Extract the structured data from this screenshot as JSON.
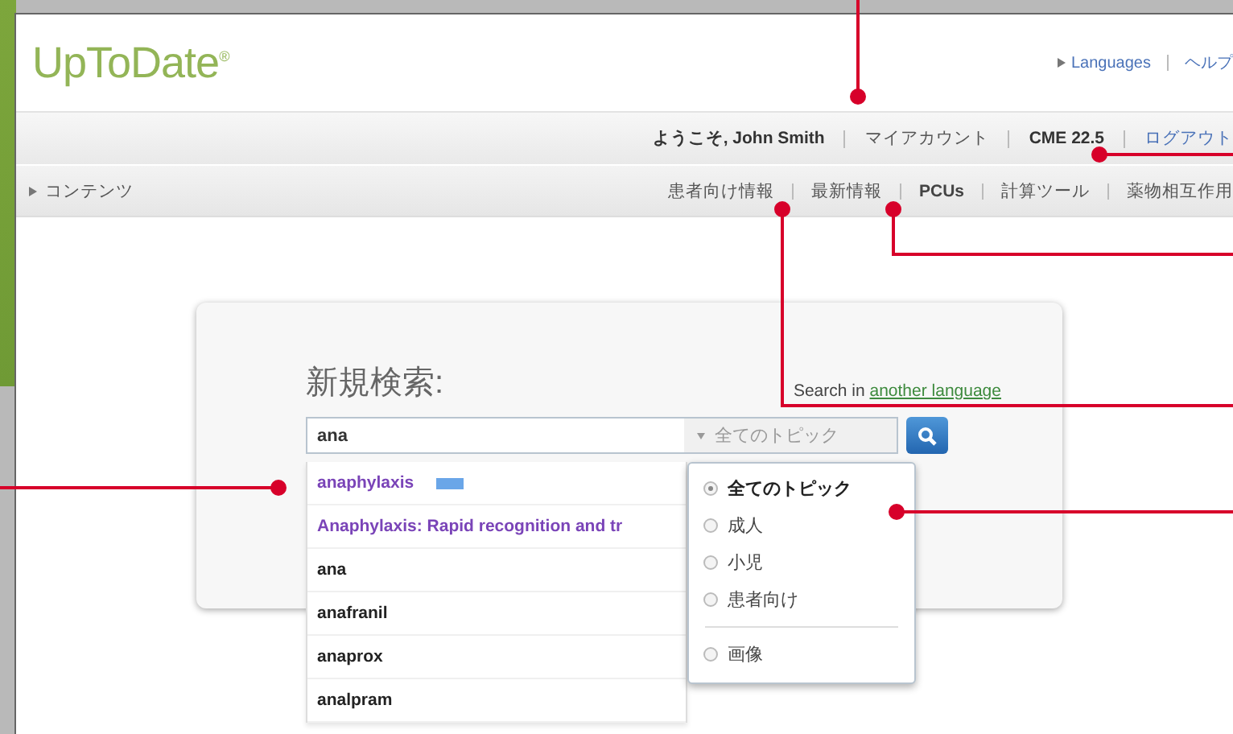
{
  "header": {
    "logo": "UpToDate",
    "logo_mark": "®",
    "links": [
      {
        "label": "Languages",
        "caret": true
      },
      {
        "label": "ヘルプ",
        "caret": false
      }
    ]
  },
  "user_bar": {
    "items": [
      {
        "text": "ようこそ, John Smith",
        "kind": "bold"
      },
      {
        "text": "マイアカウント",
        "kind": "plain"
      },
      {
        "text": "CME 22.5",
        "kind": "bold"
      },
      {
        "text": "ログアウト",
        "kind": "link"
      }
    ]
  },
  "nav": {
    "menu": "コンテンツ",
    "items": [
      {
        "label": "患者向け情報",
        "kind": "plain"
      },
      {
        "label": "最新情報",
        "kind": "plain"
      },
      {
        "label": "PCUs",
        "kind": "bold"
      },
      {
        "label": "計算ツール",
        "kind": "plain"
      },
      {
        "label": "薬物相互作用",
        "kind": "plain"
      }
    ]
  },
  "search": {
    "title": "新規検索:",
    "language_prefix": "Search in",
    "language_link": "another language",
    "query": "ana",
    "topic": "全てのトピック",
    "suggestions": [
      {
        "text": "anaphylaxis",
        "kind": "topic",
        "badge": true
      },
      {
        "text": "Anaphylaxis: Rapid recognition and tr",
        "kind": "topic",
        "badge": false
      },
      {
        "text": "ana",
        "kind": "term",
        "badge": false
      },
      {
        "text": "anafranil",
        "kind": "term",
        "badge": false
      },
      {
        "text": "anaprox",
        "kind": "term",
        "badge": false
      },
      {
        "text": "analpram",
        "kind": "term",
        "badge": false
      }
    ],
    "topics": [
      {
        "label": "全てのトピック",
        "selected": true,
        "divider_before": false
      },
      {
        "label": "成人",
        "selected": false,
        "divider_before": false
      },
      {
        "label": "小児",
        "selected": false,
        "divider_before": false
      },
      {
        "label": "患者向け",
        "selected": false,
        "divider_before": false
      },
      {
        "label": "画像",
        "selected": false,
        "divider_before": true
      }
    ]
  }
}
